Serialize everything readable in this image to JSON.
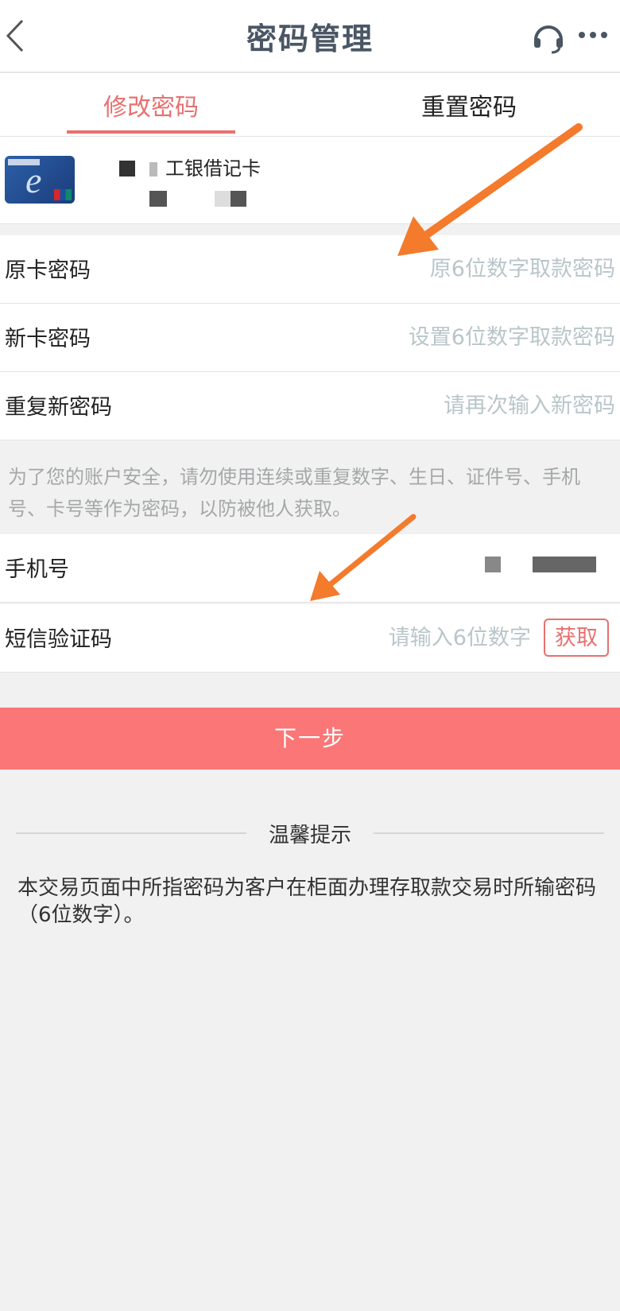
{
  "header": {
    "title": "密码管理",
    "back_icon": "back-chevron-icon",
    "support_icon": "headset-icon",
    "more_icon": "more-dots-icon"
  },
  "tabs": [
    {
      "label": "修改密码",
      "active": true
    },
    {
      "label": "重置密码",
      "active": false
    }
  ],
  "card": {
    "name": "工银借记卡",
    "icon": "icbc-card-icon"
  },
  "form": {
    "original_password": {
      "label": "原卡密码",
      "placeholder": "原6位数字取款密码"
    },
    "new_password": {
      "label": "新卡密码",
      "placeholder": "设置6位数字取款密码"
    },
    "repeat_password": {
      "label": "重复新密码",
      "placeholder": "请再次输入新密码"
    },
    "tip": "为了您的账户安全，请勿使用连续或重复数字、生日、证件号、手机号、卡号等作为密码，以防被他人获取。",
    "phone": {
      "label": "手机号"
    },
    "sms": {
      "label": "短信验证码",
      "placeholder": "请输入6位数字",
      "button": "获取"
    }
  },
  "next_button": "下一步",
  "tips": {
    "title": "温馨提示",
    "body": "本交易页面中所指密码为客户在柜面办理存取款交易时所输密码（6位数字）。"
  },
  "colors": {
    "accent": "#e8706f",
    "button_bg": "#fa7677",
    "arrow": "#f47a2c",
    "title": "#4a5663"
  }
}
